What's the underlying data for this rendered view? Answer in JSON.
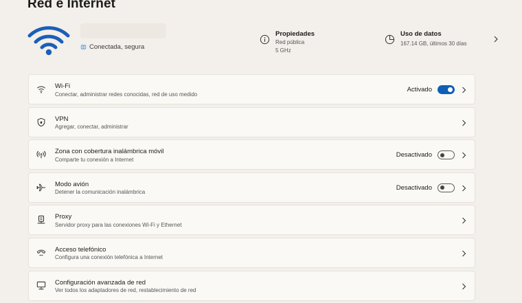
{
  "page": {
    "title": "Red e Internet"
  },
  "hero": {
    "status": "Conectada, segura",
    "properties": {
      "title": "Propiedades",
      "line1": "Red pública",
      "line2": "5 GHz"
    },
    "usage": {
      "title": "Uso de datos",
      "detail": "167.14 GB, últimos 30 días"
    }
  },
  "items": [
    {
      "label": "Wi-Fi",
      "desc": "Conectar, administrar redes conocidas, red de uso medido",
      "state": "Activado",
      "toggle": "on",
      "icon": "wifi-icon"
    },
    {
      "label": "VPN",
      "desc": "Agregar, conectar, administrar",
      "icon": "shield-icon"
    },
    {
      "label": "Zona con cobertura inalámbrica móvil",
      "desc": "Comparte tu conexión a Internet",
      "state": "Desactivado",
      "toggle": "off",
      "icon": "hotspot-icon"
    },
    {
      "label": "Modo avión",
      "desc": "Detener la comunicación inalámbrica",
      "state": "Desactivado",
      "toggle": "off",
      "icon": "airplane-icon"
    },
    {
      "label": "Proxy",
      "desc": "Servidor proxy para las conexiones Wi-Fi y Ethernet",
      "icon": "proxy-icon"
    },
    {
      "label": "Acceso telefónico",
      "desc": "Configura una conexión telefónica a Internet",
      "icon": "dialup-icon"
    },
    {
      "label": "Configuración avanzada de red",
      "desc": "Ver todos los adaptadores de red, restablecimiento de red",
      "icon": "network-adapter-icon"
    }
  ],
  "colors": {
    "accent": "#0f5fb5",
    "background": "#f3efea",
    "card": "#fbf9f6"
  }
}
